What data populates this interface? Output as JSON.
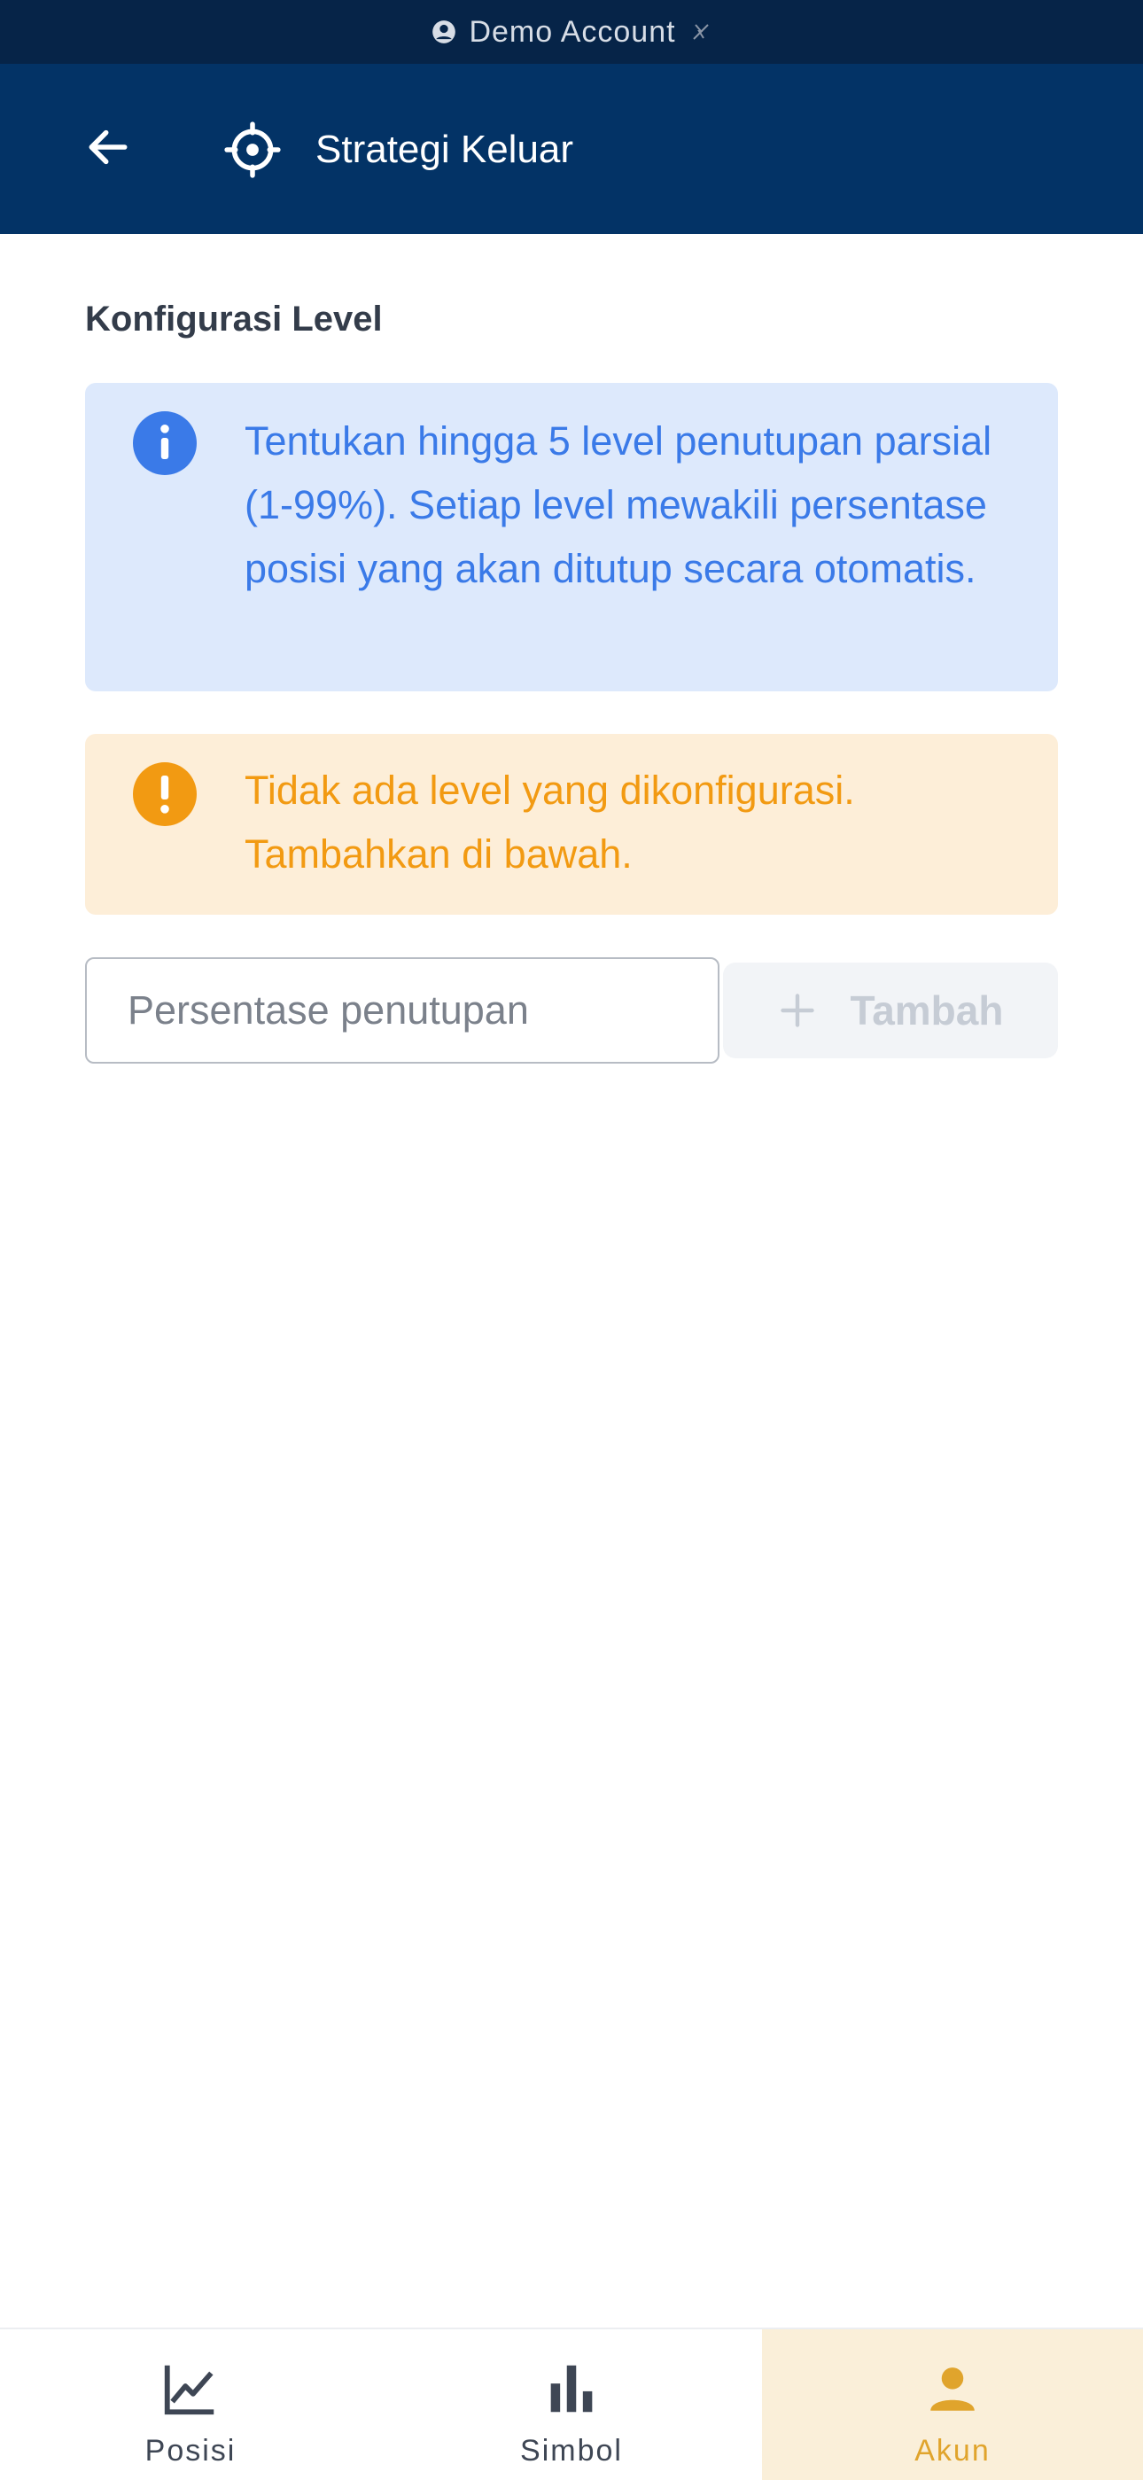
{
  "status_bar": {
    "account_label": "Demo Account"
  },
  "app_bar": {
    "title": "Strategi Keluar"
  },
  "section": {
    "title": "Konfigurasi Level"
  },
  "info": {
    "text": "Tentukan hingga 5 level penutupan parsial (1-99%). Setiap level mewakili persentase posisi yang akan ditutup secara otomatis."
  },
  "warning": {
    "text": "Tidak ada level yang dikonfigurasi. Tambahkan di bawah."
  },
  "level_input": {
    "placeholder": "Persentase penutupan",
    "value": ""
  },
  "add_button": {
    "label": "Tambah",
    "enabled": false
  },
  "bottom_nav": {
    "items": [
      {
        "label": "Posisi",
        "icon": "line-chart-icon",
        "active": false
      },
      {
        "label": "Simbol",
        "icon": "bar-chart-icon",
        "active": false
      },
      {
        "label": "Akun",
        "icon": "person-icon",
        "active": true
      }
    ]
  },
  "colors": {
    "header_bg": "#033366",
    "status_bg": "#062448",
    "info_bg": "#dde9fc",
    "info_text": "#3a7ae8",
    "warn_bg": "#fdeed8",
    "warn_text": "#f29a12",
    "active_tab": "#e0a42c"
  }
}
